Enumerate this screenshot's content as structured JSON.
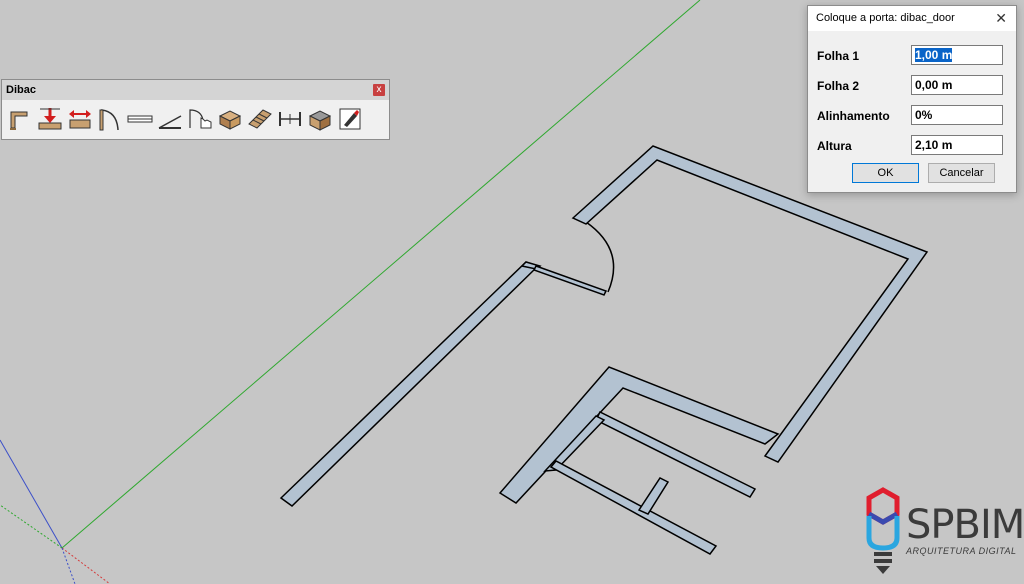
{
  "toolbar": {
    "title": "Dibac",
    "close_glyph": "x",
    "tools": [
      "wall-tool-icon",
      "insert-door-icon",
      "stretch-icon",
      "door-swing-icon",
      "window-icon",
      "stair-line-icon",
      "hand-pointer-icon",
      "3d-object-icon",
      "stairs-icon",
      "dimension-icon",
      "furniture-icon",
      "edit-icon"
    ]
  },
  "dialog": {
    "title": "Coloque a porta: dibac_door",
    "close_glyph": "✕",
    "fields": [
      {
        "label": "Folha 1",
        "value": "1,00 m"
      },
      {
        "label": "Folha 2",
        "value": "0,00 m"
      },
      {
        "label": "Alinhamento",
        "value": "0%"
      },
      {
        "label": "Altura",
        "value": "2,10 m"
      }
    ],
    "ok_label": "OK",
    "cancel_label": "Cancelar"
  },
  "logo": {
    "text": "SPBIM",
    "subtitle": "ARQUITETURA DIGITAL"
  },
  "colors": {
    "background": "#c6c6c6",
    "wall_fill": "#b3c2d1",
    "green_axis": "#2fa82f",
    "blue_axis": "#3c50c8",
    "red_axis": "#d43c3c"
  }
}
